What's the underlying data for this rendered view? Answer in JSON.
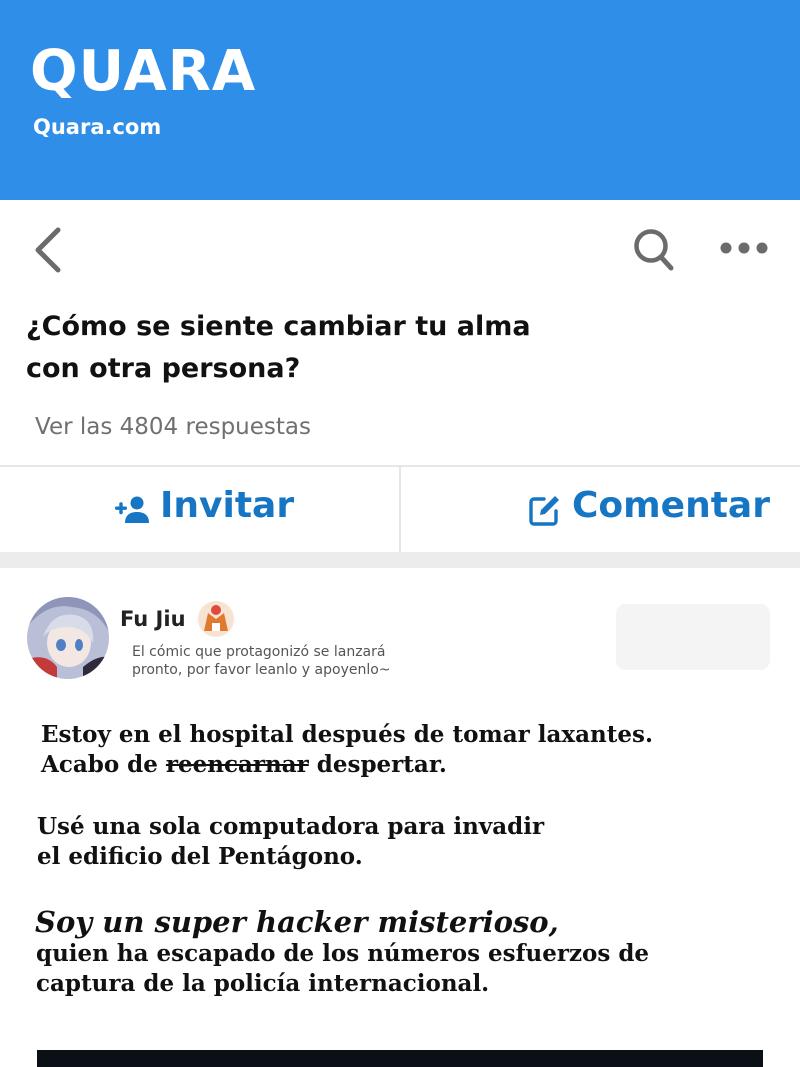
{
  "header": {
    "brand": "QUARA",
    "subtitle": "Quara.com",
    "color": "#2f8fe8"
  },
  "navbar": {
    "back_icon": "chevron-left-icon",
    "search_icon": "search-icon",
    "more_icon": "more-dots-icon"
  },
  "question": {
    "title_line1": "¿Cómo se siente cambiar tu alma",
    "title_line2": "con otra persona?",
    "answers_link": "Ver las 4804 respuestas"
  },
  "actions": {
    "invite_label": "Invitar",
    "invite_icon": "person-add-icon",
    "comment_label": "Comentar",
    "comment_icon": "edit-icon",
    "accent": "#1676c4"
  },
  "answer": {
    "author_name": "Fu Jiu",
    "bio_line1": "El cómic que protagonizó se lanzará",
    "bio_line2": "pronto, por favor leanlo y apoyenlo~",
    "paragraph1": {
      "line1": "Estoy en el hospital después de tomar laxantes.",
      "line2_prefix": "Acabo de ",
      "line2_struck": "reencarnar",
      "line2_suffix": " despertar."
    },
    "paragraph2": {
      "line1": "Usé una sola computadora para invadir",
      "line2": "el edificio del Pentágono."
    },
    "paragraph3": {
      "heading": "Soy un super hacker misterioso,",
      "line1": "quien ha escapado de los números esfuerzos de",
      "line2": "captura de la policía internacional."
    }
  }
}
